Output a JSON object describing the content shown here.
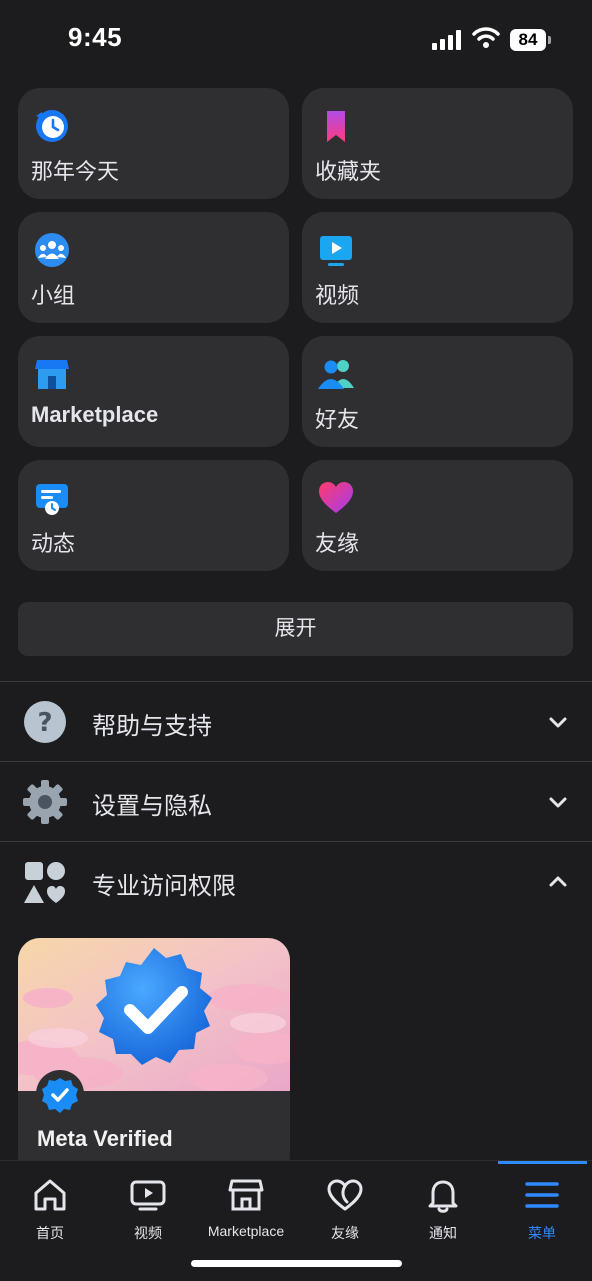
{
  "status": {
    "time": "9:45",
    "battery": "84"
  },
  "shortcuts": [
    {
      "label": "那年今天",
      "icon": "clock-history-icon"
    },
    {
      "label": "收藏夹",
      "icon": "bookmark-icon"
    },
    {
      "label": "小组",
      "icon": "groups-icon"
    },
    {
      "label": "视频",
      "icon": "video-screen-icon"
    },
    {
      "label": "Marketplace",
      "icon": "storefront-icon"
    },
    {
      "label": "好友",
      "icon": "friends-icon"
    },
    {
      "label": "动态",
      "icon": "feeds-icon"
    },
    {
      "label": "友缘",
      "icon": "dating-heart-icon"
    }
  ],
  "expand_label": "展开",
  "sections": [
    {
      "title": "帮助与支持",
      "icon": "help-question-icon",
      "expanded": false
    },
    {
      "title": "设置与隐私",
      "icon": "settings-gear-icon",
      "expanded": false
    },
    {
      "title": "专业访问权限",
      "icon": "shapes-icon",
      "expanded": true
    }
  ],
  "meta_verified": {
    "title": "Meta Verified"
  },
  "nav": [
    {
      "label": "首页",
      "icon": "home-icon"
    },
    {
      "label": "视频",
      "icon": "video-icon"
    },
    {
      "label": "Marketplace",
      "icon": "marketplace-icon"
    },
    {
      "label": "友缘",
      "icon": "dating-icon"
    },
    {
      "label": "通知",
      "icon": "bell-icon"
    },
    {
      "label": "菜单",
      "icon": "menu-icon",
      "active": true
    }
  ],
  "colors": {
    "accent": "#2e89ff",
    "background": "#1c1c1e",
    "card": "#2f2f32"
  }
}
